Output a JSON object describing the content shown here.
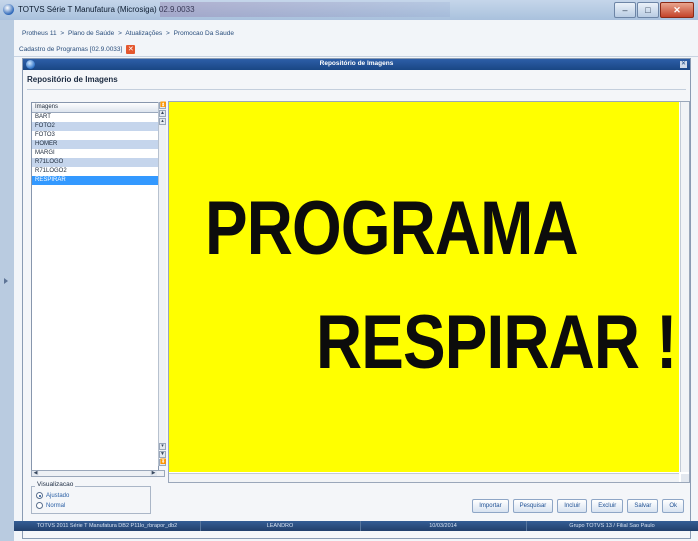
{
  "window": {
    "title": "TOTVS Série T Manufatura (Microsiga) 02.9.0033",
    "controls": [
      "minimize",
      "maximize",
      "close"
    ]
  },
  "breadcrumb": [
    "Protheus 11",
    ">",
    "Plano de Saúde",
    ">",
    "Atualizações",
    ">",
    "Promocao Da Saude"
  ],
  "tab": {
    "label": "Cadastro de Programas [02.9.0033]"
  },
  "dialog": {
    "title": "Repositório de Imagens",
    "header": "Repositório de Imagens",
    "list": {
      "column": "Imagens",
      "items": [
        "BART",
        "FOTO2",
        "FOTO3",
        "HOMER",
        "MARGI",
        "R71LOGO",
        "R71LOGO2",
        "RESPIRAR"
      ],
      "selected": "RESPIRAR"
    },
    "image": {
      "line1": "PROGRAMA",
      "line2": "RESPIRAR !",
      "background": "#ffff00"
    },
    "view": {
      "label": "Visualizacao",
      "options": [
        "Ajustado",
        "Normal"
      ],
      "selected": "Ajustado"
    },
    "buttons": [
      "Importar",
      "Pesquisar",
      "Incluir",
      "Excluir",
      "Salvar",
      "Ok"
    ]
  },
  "status": {
    "app": "TOTVS 2011 Série T Manufatura DB2 P11lo_rbrapor_db2",
    "user": "LEANDRO",
    "date": "10/03/2014",
    "group": "Grupo TOTVS 13 / Filial Sao Paulo"
  },
  "colors": {
    "accent": "#194784",
    "selection": "#3399ff",
    "poster": "#ffff00"
  }
}
